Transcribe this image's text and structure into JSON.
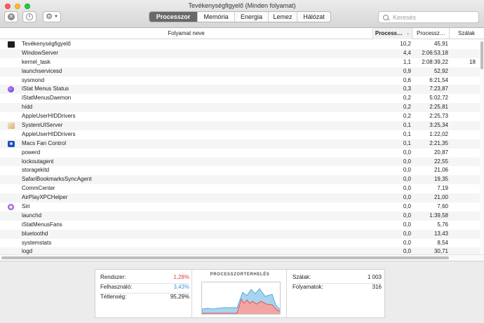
{
  "window": {
    "title": "Tevékenységfigyelő (Minden folyamat)"
  },
  "toolbar": {
    "tabs": [
      {
        "label": "Processzor",
        "active": true
      },
      {
        "label": "Memória",
        "active": false
      },
      {
        "label": "Energia",
        "active": false
      },
      {
        "label": "Lemez",
        "active": false
      },
      {
        "label": "Hálózat",
        "active": false
      }
    ],
    "search_placeholder": "Keresés",
    "stop_icon": "stop-process-icon",
    "info_icon": "info-icon",
    "gear_icon": "gear-icon"
  },
  "table": {
    "columns": {
      "name": "Folyamat neve",
      "cpu": "Process…",
      "cpu_time": "Processz…",
      "threads": "Szálak"
    },
    "rows": [
      {
        "name": "Tevékenységfigyelő",
        "cpu": "10,2",
        "time": "45,91",
        "threads": "",
        "icon": "terminal"
      },
      {
        "name": "WindowServer",
        "cpu": "4,4",
        "time": "2:06:53,18",
        "threads": ""
      },
      {
        "name": "kernel_task",
        "cpu": "1,1",
        "time": "2:08:39,22",
        "threads": "18"
      },
      {
        "name": "launchservicesd",
        "cpu": "0,9",
        "time": "52,92",
        "threads": ""
      },
      {
        "name": "sysmond",
        "cpu": "0,6",
        "time": "6:21,54",
        "threads": ""
      },
      {
        "name": "iStat Menus Status",
        "cpu": "0,3",
        "time": "7:23,87",
        "threads": "",
        "icon": "istat"
      },
      {
        "name": "iStatMenusDaemon",
        "cpu": "0,2",
        "time": "5:02,72",
        "threads": ""
      },
      {
        "name": "hidd",
        "cpu": "0,2",
        "time": "2:25,81",
        "threads": ""
      },
      {
        "name": "AppleUserHIDDrivers",
        "cpu": "0,2",
        "time": "2:25,73",
        "threads": ""
      },
      {
        "name": "SystemUIServer",
        "cpu": "0,1",
        "time": "3:25,34",
        "threads": "",
        "icon": "sysui"
      },
      {
        "name": "AppleUserHIDDrivers",
        "cpu": "0,1",
        "time": "1:22,02",
        "threads": ""
      },
      {
        "name": "Macs Fan Control",
        "cpu": "0,1",
        "time": "2:21,35",
        "threads": "",
        "icon": "fan"
      },
      {
        "name": "powerd",
        "cpu": "0,0",
        "time": "20,87",
        "threads": ""
      },
      {
        "name": "lockoutagent",
        "cpu": "0,0",
        "time": "22,55",
        "threads": ""
      },
      {
        "name": "storagekitd",
        "cpu": "0,0",
        "time": "21,06",
        "threads": ""
      },
      {
        "name": "SafariBookmarksSyncAgent",
        "cpu": "0,0",
        "time": "19,35",
        "threads": ""
      },
      {
        "name": "CommCenter",
        "cpu": "0,0",
        "time": "7,19",
        "threads": ""
      },
      {
        "name": "AirPlayXPCHelper",
        "cpu": "0,0",
        "time": "21,00",
        "threads": ""
      },
      {
        "name": "Siri",
        "cpu": "0,0",
        "time": "7,60",
        "threads": "",
        "icon": "siri"
      },
      {
        "name": "launchd",
        "cpu": "0,0",
        "time": "1:39,58",
        "threads": ""
      },
      {
        "name": "iStatMenusFans",
        "cpu": "0,0",
        "time": "5,76",
        "threads": ""
      },
      {
        "name": "bluetoothd",
        "cpu": "0,0",
        "time": "13,43",
        "threads": ""
      },
      {
        "name": "systemstats",
        "cpu": "0,0",
        "time": "8,54",
        "threads": ""
      },
      {
        "name": "logd",
        "cpu": "0,0",
        "time": "30,71",
        "threads": ""
      }
    ]
  },
  "summary": {
    "system_label": "Rendszer:",
    "system_value": "1,28%",
    "user_label": "Felhasználó:",
    "user_value": "3,43%",
    "idle_label": "Tétlenség:",
    "idle_value": "95,29%",
    "graph_title": "PROCESSZORTERHELÉS",
    "threads_label": "Szálak:",
    "threads_value": "1 003",
    "processes_label": "Folyamatok:",
    "processes_value": "316",
    "colors": {
      "system": "#e0403c",
      "user": "#3b9ad9"
    }
  }
}
